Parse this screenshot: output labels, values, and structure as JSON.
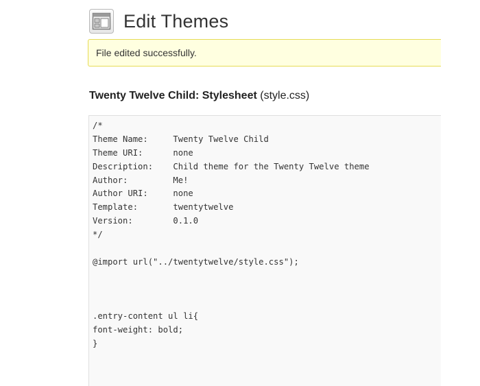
{
  "header": {
    "icon": "appearance-layout-icon",
    "title": "Edit Themes"
  },
  "notice": {
    "message": "File edited successfully."
  },
  "file": {
    "theme_label": "Twenty Twelve Child: Stylesheet",
    "filename": "(style.css)"
  },
  "editor": {
    "lines": [
      "/*",
      "Theme Name:     Twenty Twelve Child",
      "Theme URI:      none",
      "Description:    Child theme for the Twenty Twelve theme",
      "Author:         Me!",
      "Author URI:     none",
      "Template:       twentytwelve",
      "Version:        0.1.0",
      "*/",
      "",
      "@import url(\"../twentytwelve/style.css\");",
      "",
      "",
      "",
      ".entry-content ul li{",
      "font-weight: bold;",
      "}",
      "",
      "",
      ""
    ]
  }
}
